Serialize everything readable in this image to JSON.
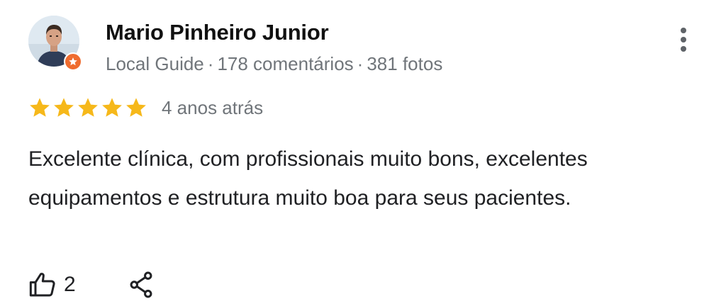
{
  "reviewer": {
    "name": "Mario Pinheiro Junior",
    "guide_label": "Local Guide",
    "separator": "·",
    "reviews_count": "178 comentários",
    "photos_count": "381 fotos",
    "avatar_icon": "user-photo",
    "badge_icon": "local-guide-star-badge",
    "badge_color": "#ef6c2f"
  },
  "review": {
    "rating": 5,
    "rating_max": 5,
    "star_color": "#f6b81a",
    "date": "4 anos atrás",
    "text": "Excelente clínica, com profissionais muito bons, excelentes equipamentos e estrutura muito boa para seus pacientes."
  },
  "actions": {
    "like_count": "2",
    "like_icon": "thumbs-up-icon",
    "share_icon": "share-icon",
    "more_icon": "more-vert-icon"
  }
}
